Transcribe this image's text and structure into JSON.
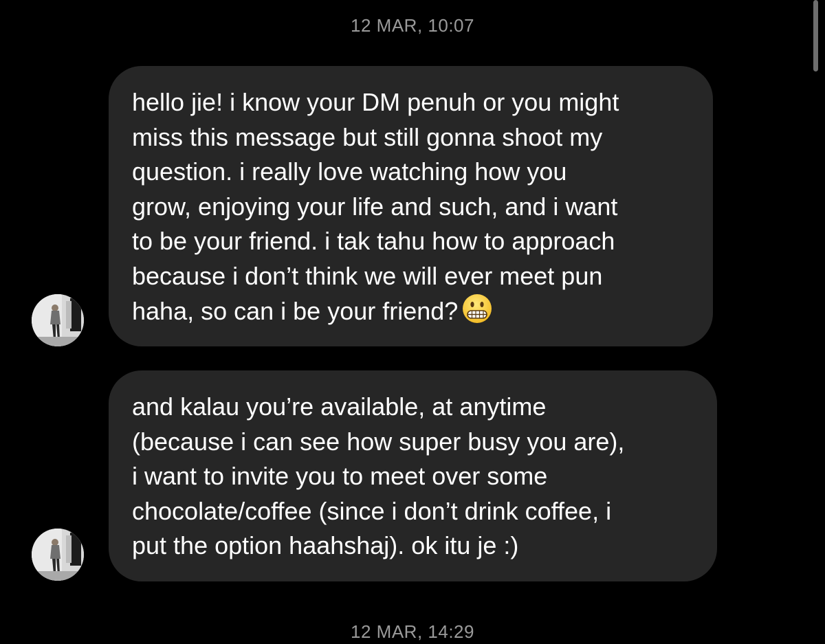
{
  "conversation": {
    "timestamps": {
      "top": "12 MAR, 10:07",
      "bottom": "12 MAR, 14:29"
    },
    "messages": [
      {
        "lines": [
          "hello jie! i know your DM penuh or you might",
          "miss this message but still gonna shoot my",
          "question. i really love watching how you",
          "grow, enjoying your life and such, and i want",
          "to be your friend. i tak tahu how to approach",
          "because i don’t think we will ever meet pun",
          "haha, so can i be your friend?"
        ],
        "emoji": "grimacing-face-icon"
      },
      {
        "lines": [
          "and kalau you’re available, at anytime",
          "(because i can see how super busy you are),",
          "i want to invite you to meet over some",
          "chocolate/coffee (since i don’t drink coffee, i",
          "put the option haahshaj). ok itu je :)"
        ]
      }
    ]
  },
  "colors": {
    "background": "#000000",
    "bubble": "#262626",
    "text": "#ffffff",
    "timestamp": "#9a9a9a"
  }
}
